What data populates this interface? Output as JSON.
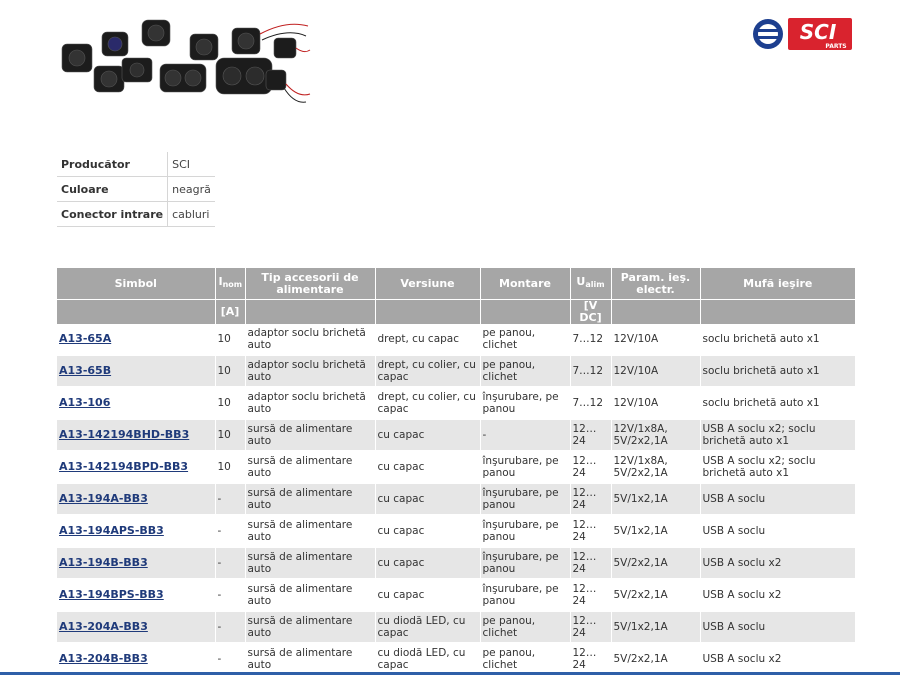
{
  "brand": {
    "logo_text": "SCI",
    "logo_sub": "PARTS",
    "accent": "#d9232e",
    "secondary": "#1d3f8f"
  },
  "properties": [
    {
      "label": "Producător",
      "value": "SCI"
    },
    {
      "label": "Culoare",
      "value": "neagră"
    },
    {
      "label": "Conector intrare",
      "value": "cabluri"
    }
  ],
  "table": {
    "headers": {
      "symbol": "Simbol",
      "inom_base": "I",
      "inom_sub": "nom",
      "type": "Tip accesorii de alimentare",
      "version": "Versiune",
      "mounting": "Montare",
      "ualim_base": "U",
      "ualim_sub": "alim",
      "params": "Param. ieş. electr.",
      "output": "Mufă ieşire"
    },
    "units": {
      "inom": "[A]",
      "ualim": "[V DC]"
    },
    "rows": [
      {
        "symbol": "A13-65A",
        "inom": "10",
        "type": "adaptor soclu brichetă auto",
        "version": "drept, cu capac",
        "mounting": "pe panou, clichet",
        "ualim": "7…12",
        "params": "12V/10A",
        "output": "soclu brichetă auto x1"
      },
      {
        "symbol": "A13-65B",
        "inom": "10",
        "type": "adaptor soclu brichetă auto",
        "version": "drept, cu colier, cu capac",
        "mounting": "pe panou, clichet",
        "ualim": "7…12",
        "params": "12V/10A",
        "output": "soclu brichetă auto x1"
      },
      {
        "symbol": "A13-106",
        "inom": "10",
        "type": "adaptor soclu brichetă auto",
        "version": "drept, cu colier, cu capac",
        "mounting": "înşurubare, pe panou",
        "ualim": "7…12",
        "params": "12V/10A",
        "output": "soclu brichetă auto x1"
      },
      {
        "symbol": "A13-142194BHD-BB3",
        "inom": "10",
        "type": "sursă de alimentare auto",
        "version": "cu capac",
        "mounting": "-",
        "ualim": "12…24",
        "params": "12V/1x8A, 5V/2x2,1A",
        "output": "USB A soclu x2; soclu brichetă auto x1"
      },
      {
        "symbol": "A13-142194BPD-BB3",
        "inom": "10",
        "type": "sursă de alimentare auto",
        "version": "cu capac",
        "mounting": "înşurubare, pe panou",
        "ualim": "12…24",
        "params": "12V/1x8A, 5V/2x2,1A",
        "output": "USB A soclu x2; soclu brichetă auto x1"
      },
      {
        "symbol": "A13-194A-BB3",
        "inom": "-",
        "type": "sursă de alimentare auto",
        "version": "cu capac",
        "mounting": "înşurubare, pe panou",
        "ualim": "12…24",
        "params": "5V/1x2,1A",
        "output": "USB A soclu"
      },
      {
        "symbol": "A13-194APS-BB3",
        "inom": "-",
        "type": "sursă de alimentare auto",
        "version": "cu capac",
        "mounting": "înşurubare, pe panou",
        "ualim": "12…24",
        "params": "5V/1x2,1A",
        "output": "USB A soclu"
      },
      {
        "symbol": "A13-194B-BB3",
        "inom": "-",
        "type": "sursă de alimentare auto",
        "version": "cu capac",
        "mounting": "înşurubare, pe panou",
        "ualim": "12…24",
        "params": "5V/2x2,1A",
        "output": "USB A soclu x2"
      },
      {
        "symbol": "A13-194BPS-BB3",
        "inom": "-",
        "type": "sursă de alimentare auto",
        "version": "cu capac",
        "mounting": "înşurubare, pe panou",
        "ualim": "12…24",
        "params": "5V/2x2,1A",
        "output": "USB A soclu x2"
      },
      {
        "symbol": "A13-204A-BB3",
        "inom": "-",
        "type": "sursă de alimentare auto",
        "version": "cu diodă LED, cu capac",
        "mounting": "pe panou, clichet",
        "ualim": "12…24",
        "params": "5V/1x2,1A",
        "output": "USB A soclu"
      },
      {
        "symbol": "A13-204B-BB3",
        "inom": "-",
        "type": "sursă de alimentare auto",
        "version": "cu diodă LED, cu capac",
        "mounting": "pe panou, clichet",
        "ualim": "12…24",
        "params": "5V/2x2,1A",
        "output": "USB A soclu x2"
      }
    ]
  }
}
